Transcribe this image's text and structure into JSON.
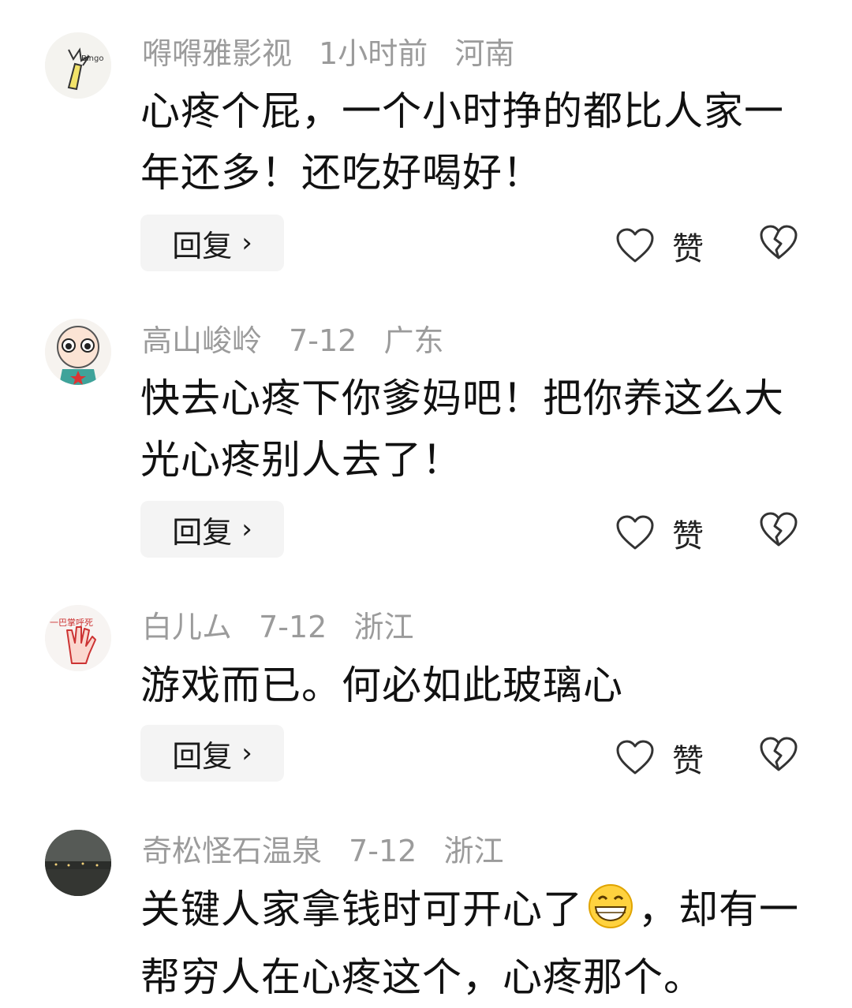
{
  "ui": {
    "reply_label": "回复",
    "reply_chevron": "›",
    "like_label": "赞"
  },
  "comments": [
    {
      "username": "嘚嘚雅影视",
      "time": "1小时前",
      "location": "河南",
      "body": "心疼个屁，一个小时挣的都比人家一年还多！还吃好喝好！",
      "avatar_text": "Bingo"
    },
    {
      "username": "高山峻岭",
      "time": "7-12",
      "location": "广东",
      "body": "快去心疼下你爹妈吧！把你养这么大光心疼别人去了！"
    },
    {
      "username": "白儿ム",
      "time": "7-12",
      "location": "浙江",
      "body": "游戏而已。何必如此玻璃心",
      "avatar_text": "一巴掌呼死"
    },
    {
      "username": "奇松怪石温泉",
      "time": "7-12",
      "location": "浙江",
      "body_part1": "关键人家拿钱时可开心了",
      "body_emoji": "grinning-face-emoji",
      "body_part2": "，却有一帮穷人在心疼这个，心疼那个。"
    }
  ]
}
